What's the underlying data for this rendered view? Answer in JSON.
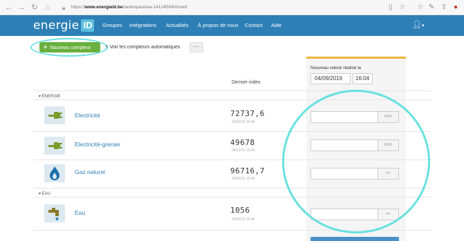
{
  "browser": {
    "url_prefix": "https://",
    "url_domain": "www.energieid.be",
    "url_path": "/workspace/ea-14124594/#/card"
  },
  "navbar": {
    "logo_text": "energie",
    "logo_badge": "ID",
    "links": [
      "Groupes",
      "Intégrations",
      "Actualités",
      "À propos de nous",
      "Contact",
      "Aide"
    ]
  },
  "toolbar": {
    "new_meter_label": "Nouveau compteur",
    "auto_meters_label": "Voir les compteurs automatiques",
    "more_label": "···"
  },
  "reading": {
    "label": "Nouveau relevé réalisé le",
    "date": "04/09/2019",
    "time": "16:04"
  },
  "columns": {
    "last_index": "Dernier index"
  },
  "sections": [
    {
      "label": "▾ ÉNERGIE",
      "meters": [
        {
          "name": "Electricité",
          "index": "72737,6",
          "date": "28/02/19 15:46",
          "unit": "kWh",
          "icon": "electric-plug-icon"
        },
        {
          "name": "Electricité-grenier",
          "index": "49678",
          "date": "06/01/19 15:49",
          "unit": "kWh",
          "icon": "electric-plug-icon"
        },
        {
          "name": "Gaz naturel",
          "index": "96716,7",
          "date": "28/02/19 15:46",
          "unit": "m³",
          "icon": "gas-flame-icon"
        }
      ]
    },
    {
      "label": "▾ EAU",
      "meters": [
        {
          "name": "Eau",
          "index": "1056",
          "date": "28/02/19 15:46",
          "unit": "m³",
          "icon": "water-tap-icon"
        }
      ]
    }
  ],
  "colors": {
    "navbar": "#2d7fb6",
    "primary_button": "#6ab03f",
    "highlight_ring": "#68e0e0",
    "panel_accent": "#f0b43a"
  }
}
